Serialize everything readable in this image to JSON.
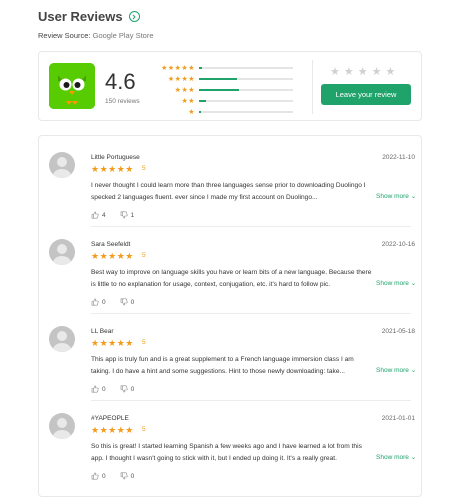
{
  "header": {
    "title": "User Reviews",
    "source_label": "Review Source:",
    "source_value": "Google Play Store"
  },
  "summary": {
    "rating": "4.6",
    "review_count": "150 reviews",
    "distribution": [
      {
        "stars": "★★★★★",
        "fraction": 0.03
      },
      {
        "stars": "★★★★",
        "fraction": 0.4
      },
      {
        "stars": "★★★",
        "fraction": 0.43
      },
      {
        "stars": "★★",
        "fraction": 0.07
      },
      {
        "stars": "★",
        "fraction": 0.02
      }
    ],
    "empty_stars": "★★★★★",
    "leave_review_label": "Leave your review",
    "accent_color": "#1fa36b",
    "star_color": "#f29b1b"
  },
  "reviews": [
    {
      "author": "Little Portuguese",
      "date": "2022-11-10",
      "stars": "★★★★★",
      "score": "5",
      "text": "I never thought I could learn more than three languages sense prior to downloading Duolingo I specked 2 languages fluent. ever since I made my first account on Duolingo...",
      "show_more": "Show more",
      "likes": "4",
      "dislikes": "1"
    },
    {
      "author": "Sara Seefeldt",
      "date": "2022-10-16",
      "stars": "★★★★★",
      "score": "5",
      "text": "Best way to improve on language skills you have or learn bits of a new language. Because there is little to no explanation for usage, context, conjugation, etc. it's hard to follow pic.",
      "show_more": "Show more",
      "likes": "0",
      "dislikes": "0"
    },
    {
      "author": "LL Bear",
      "date": "2021-05-18",
      "stars": "★★★★★",
      "score": "5",
      "text": "This app is truly fun and is a great supplement to a French language immersion class I am taking. I do have a hint and some suggestions. Hint to those newly downloading: take...",
      "show_more": "Show more",
      "likes": "0",
      "dislikes": "0"
    },
    {
      "author": "#YAPEOPLE",
      "date": "2021-01-01",
      "stars": "★★★★★",
      "score": "5",
      "text": "So this is great! I started learning Spanish a few weeks ago and I have learned a lot from this app. I thought I wasn't going to stick with it, but I ended up doing it. It's a really great.",
      "show_more": "Show more",
      "likes": "0",
      "dislikes": "0"
    }
  ]
}
